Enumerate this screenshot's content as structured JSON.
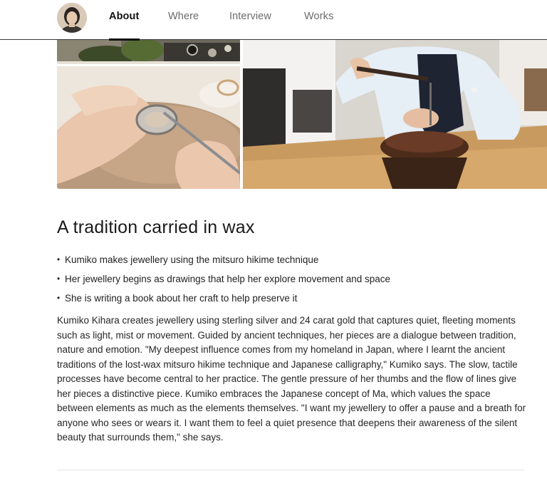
{
  "nav": {
    "items": [
      {
        "label": "About",
        "active": true
      },
      {
        "label": "Where",
        "active": false
      },
      {
        "label": "Interview",
        "active": false
      },
      {
        "label": "Works",
        "active": false
      }
    ]
  },
  "article": {
    "heading": "A tradition carried in wax",
    "bullets": [
      "Kumiko makes jewellery using the mitsuro hikime technique",
      "Her jewellery begins as drawings that help her explore movement and space",
      "She is writing a book about her craft to help preserve it"
    ],
    "body": "Kumiko Kihara creates jewellery using sterling silver and 24 carat gold that captures quiet, fleeting moments such as light, mist or movement. Guided by ancient techniques, her pieces are a dialogue between tradition, nature and emotion. \"My deepest influence comes from my homeland in Japan, where I learnt the ancient traditions of the lost-wax mitsuro hikime technique and Japanese calligraphy,\" Kumiko says. The slow, tactile processes have become central to her practice. The gentle pressure of her thumbs and the flow of lines give her pieces a distinctive piece. Kumiko embraces the Japanese concept of Ma, which values the space between elements as much as the elements themselves. \"I want my jewellery to offer a pause and a breath for anyone who sees or wears it. I want them to feel a quiet presence that deepens their awareness of the silent beauty that surrounds them,\" she says."
  },
  "colors": {
    "nav_active": "#111111",
    "nav_inactive": "#6b6b6b",
    "border": "#3a3a3a"
  }
}
